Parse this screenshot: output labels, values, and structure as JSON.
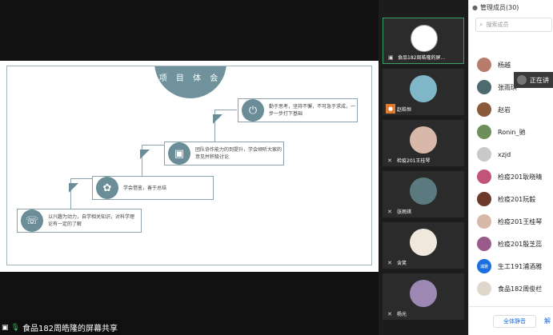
{
  "share": {
    "label": "食品182周皓隆的屏幕共享",
    "slide": {
      "title": "项 目 体 会",
      "steps": [
        {
          "icon": "whatsapp-icon",
          "glyph": "☏",
          "text": "以兴趣为动力，自学相关知识，对科学理论有一定的了解"
        },
        {
          "icon": "lightbulb-icon",
          "glyph": "✿",
          "text": "学会借鉴，善于总结"
        },
        {
          "icon": "chat-icon",
          "glyph": "▣",
          "text": "团队协作能力的到提升，学会倾听大家的意见并积极讨论"
        },
        {
          "icon": "power-icon",
          "glyph": "⏻",
          "text": "勤于思考，坚持不懈，不可急于求成，一步一步打下基础"
        }
      ]
    }
  },
  "strip": {
    "tiles": [
      {
        "name": "食品182周皓隆的屏...",
        "avatar_color": "#ffffff",
        "active": true
      },
      {
        "name": "赵皓恒",
        "avatar_color": "#7fb7c9",
        "active": false
      },
      {
        "name": "检疫201王桂琴",
        "avatar_color": "#d8b8a8",
        "active": false
      },
      {
        "name": "张雨琪",
        "avatar_color": "#5a7a80",
        "active": false
      },
      {
        "name": "含笑",
        "avatar_color": "#f0e8dc",
        "active": false
      },
      {
        "name": "杨光",
        "avatar_color": "#9d88b4",
        "active": false
      }
    ]
  },
  "panel": {
    "title": "管理成员(30)",
    "search_placeholder": "搜索成员",
    "members": [
      {
        "name": "杨越",
        "color": "#b87d6a"
      },
      {
        "name": "张雨琪",
        "color": "#4d6a6f"
      },
      {
        "name": "赵岩",
        "color": "#8a5a3a"
      },
      {
        "name": "Ronin_驰",
        "color": "#6e8f5a"
      },
      {
        "name": "xzjd",
        "color": "#c9c9c9"
      },
      {
        "name": "检疫201耿晓晴",
        "color": "#c2547a"
      },
      {
        "name": "检疫201阮毅",
        "color": "#6b3a2a"
      },
      {
        "name": "检疫201王桂琴",
        "color": "#d8b8a8"
      },
      {
        "name": "检疫201殷芝蕊",
        "color": "#9a5a8a"
      },
      {
        "name": "生工191浦酒雅",
        "color": "#1b6fe0",
        "initials": "浦雅"
      },
      {
        "name": "食品182周俊栏",
        "color": "#e0d7cc"
      }
    ],
    "mute_all": "全体静音",
    "more": "解"
  },
  "tooltip": {
    "text": "正在讲"
  }
}
